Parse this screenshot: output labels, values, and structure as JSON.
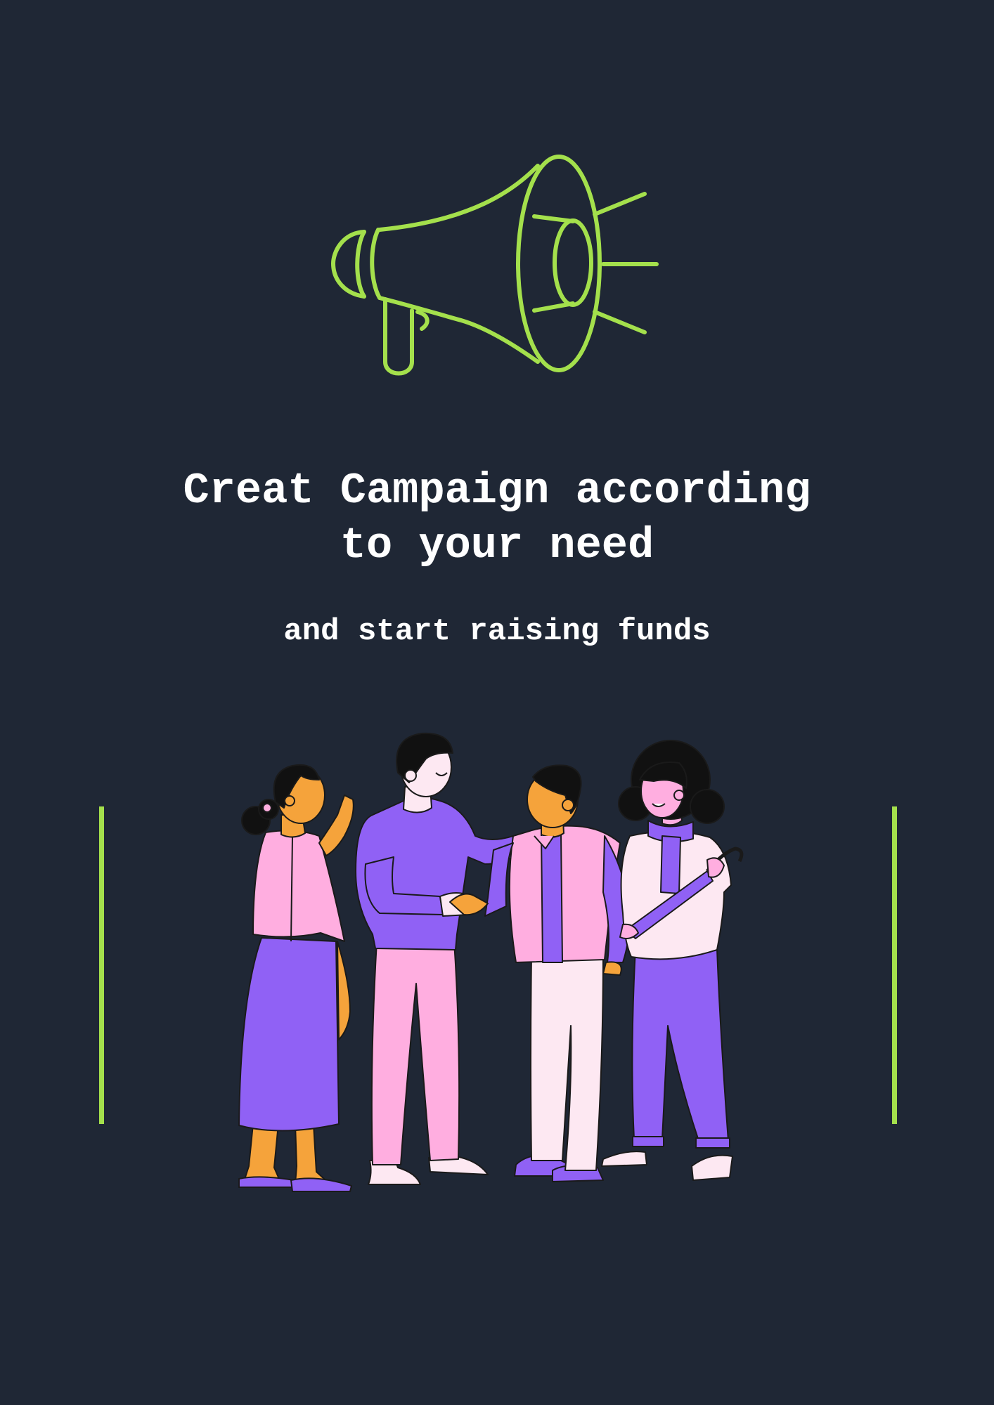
{
  "colors": {
    "background": "#1f2735",
    "accent_green": "#a4e04c",
    "purple": "#9061f5",
    "pink": "#ffaee0",
    "skin_orange": "#f5a33b",
    "text": "#ffffff"
  },
  "icons": {
    "hero": "megaphone-icon",
    "illustration": "people-greeting-illustration"
  },
  "heading": {
    "line1": "Creat Campaign according",
    "line2": "to your need"
  },
  "subheading": "and start raising funds"
}
